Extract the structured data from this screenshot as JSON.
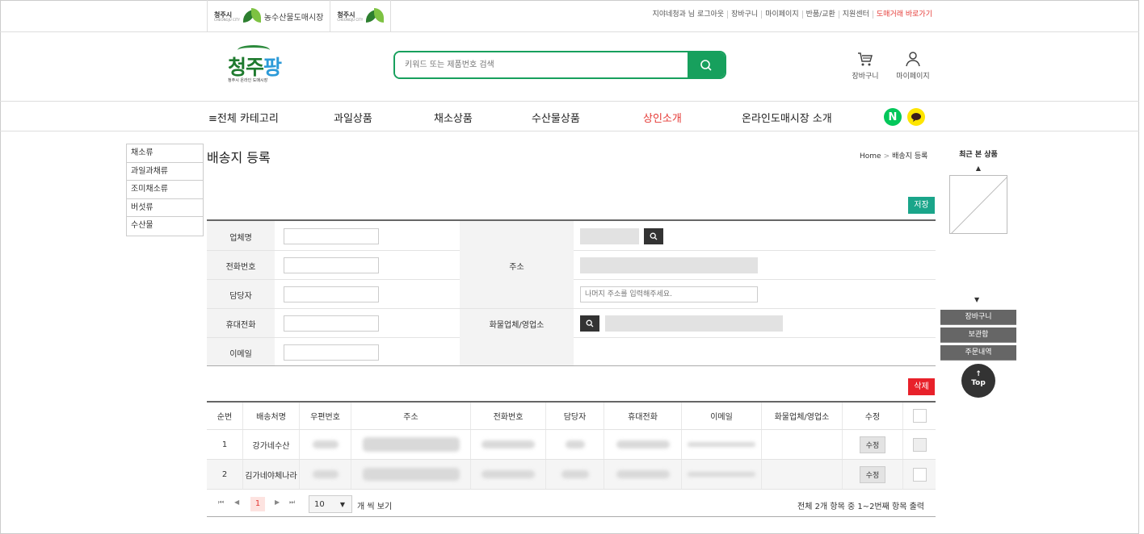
{
  "topbar": {
    "logo1_text": "농수산물도매시장",
    "logo_city": "청주시",
    "logo_city_en": "CHEONGJU CITY",
    "links": [
      "지야네청과 님 로그아웃",
      "장바구니",
      "마이페이지",
      "반품/교환",
      "지원센터",
      "도매거래 바로가기"
    ]
  },
  "header": {
    "brand_name": "청주",
    "brand_accent": "팡",
    "brand_sub": "청주시 온라인 도매시장",
    "search_placeholder": "키워드 또는 제품번호 검색",
    "cart_label": "장바구니",
    "mypage_label": "마이페이지"
  },
  "nav": {
    "all_categories": "≡전체 카테고리",
    "items": [
      "과일상품",
      "채소상품",
      "수산물상품",
      "상인소개",
      "온라인도매시장 소개"
    ],
    "active_item": "상인소개",
    "naver_badge": "N"
  },
  "left_categories": [
    "채소류",
    "과일과채류",
    "조미채소류",
    "버섯류",
    "수산물"
  ],
  "page": {
    "title": "배송지 등록",
    "breadcrumb_home": "Home",
    "breadcrumb_sep": ">",
    "breadcrumb_current": "배송지 등록",
    "save_label": "저장",
    "delete_label": "삭제"
  },
  "form": {
    "labels": [
      "업체명",
      "전화번호",
      "담당자",
      "휴대전화",
      "이메일"
    ],
    "address_label": "주소",
    "address_detail_placeholder": "나머지 주소를 입력해주세요.",
    "freight_label": "화물업체/영업소"
  },
  "table": {
    "headers": [
      "순번",
      "배송처명",
      "우편번호",
      "주소",
      "전화번호",
      "담당자",
      "휴대전화",
      "이메일",
      "화물업체/영업소",
      "수정"
    ],
    "rows": [
      {
        "no": "1",
        "name": "강가네수산",
        "edit": "수정"
      },
      {
        "no": "2",
        "name": "김가네야체나라",
        "edit": "수정"
      }
    ]
  },
  "pager": {
    "first": "⏮",
    "prev": "◀",
    "current_page": "1",
    "next": "▶",
    "last": "⏭",
    "page_size": "10",
    "page_size_suffix": "개 씩 보기",
    "summary": "전체 2개 항목 중 1~2번째 항목 출력"
  },
  "sidebar": {
    "recent_title": "최근 본 상품",
    "up_arrow": "▲",
    "down_arrow": "▼",
    "buttons": [
      "장바구니",
      "보관함",
      "주문내역"
    ],
    "top_arrow": "↑",
    "top_label": "Top"
  },
  "colors": {
    "brand_green": "#17a05d",
    "accent_red": "#e53935",
    "save_green": "#1aa58a"
  }
}
